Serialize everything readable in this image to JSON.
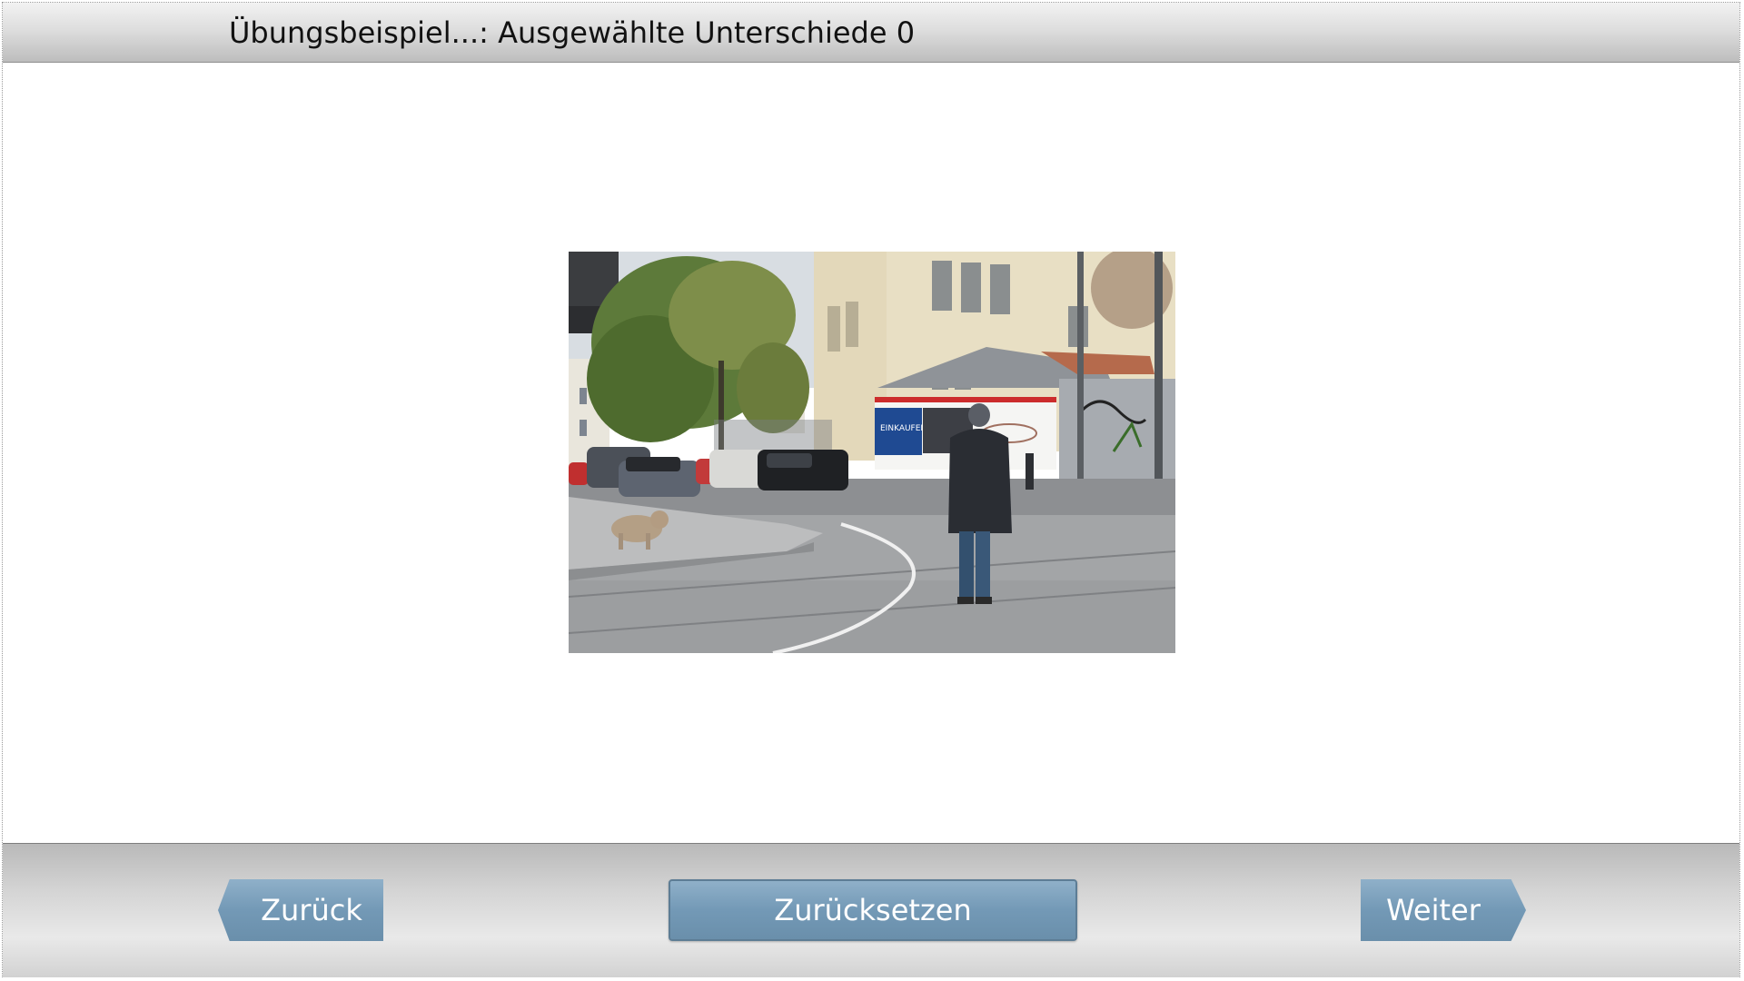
{
  "header": {
    "title": "Übungsbeispiel...: Ausgewählte Unterschiede 0"
  },
  "main": {
    "image": {
      "billboard_text": "EINKAUFEN UMS ECK?"
    }
  },
  "footer": {
    "back_label": "Zurück",
    "reset_label": "Zurücksetzen",
    "next_label": "Weiter"
  },
  "colors": {
    "button_fill": "#7399b6",
    "button_border": "#5d7d95",
    "bar_gray": "#d4d4d4"
  }
}
